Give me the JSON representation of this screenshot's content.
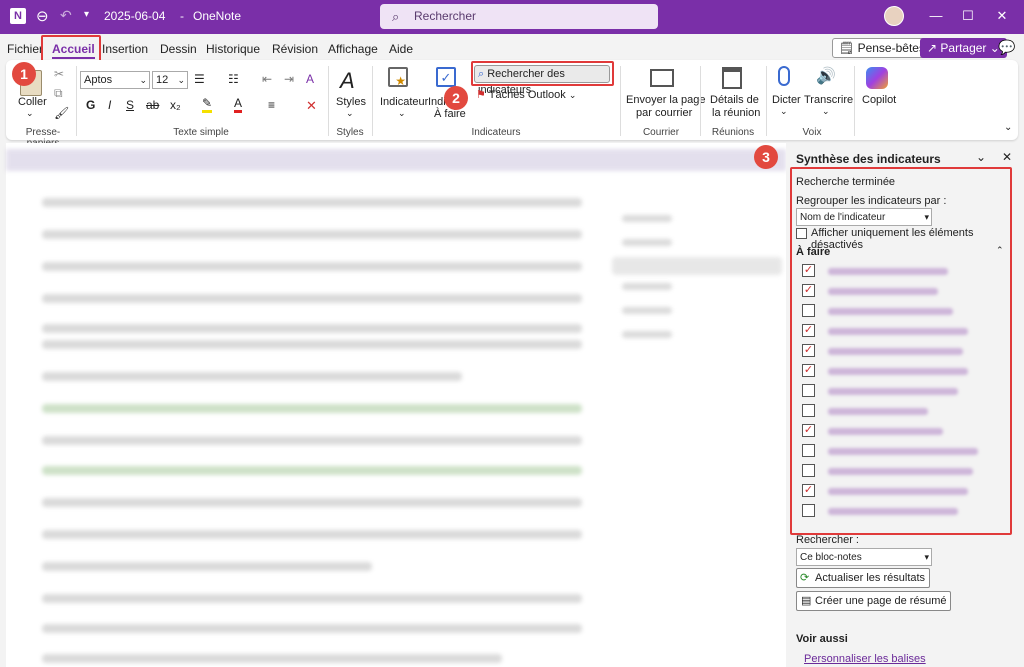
{
  "titlebar": {
    "date": "2025-06-04",
    "separator": "-",
    "app": "OneNote",
    "search_placeholder": "Rechercher"
  },
  "tabs": [
    "Fichier",
    "Accueil",
    "Insertion",
    "Dessin",
    "Historique",
    "Révision",
    "Affichage",
    "Aide"
  ],
  "top_buttons": {
    "pense_betes": "Pense-bêtes",
    "partager": "Partager"
  },
  "markers": [
    "1",
    "2",
    "3"
  ],
  "ribbon": {
    "clipboard": {
      "paste": "Coller",
      "group": "Presse-papiers"
    },
    "font": {
      "name": "Aptos",
      "size": "12",
      "group": "Texte simple"
    },
    "styles": {
      "label": "Styles",
      "group": "Styles"
    },
    "tags": {
      "indicator": "Indicateur",
      "todo_line1": "Indi",
      "todo_line2": "À faire",
      "find_tags": "Rechercher des indicateurs",
      "outlook_tasks": "Tâches Outlook",
      "group": "Indicateurs"
    },
    "email": {
      "line1": "Envoyer la page",
      "line2": "par courrier",
      "group": "Courrier"
    },
    "meeting": {
      "line1": "Détails de",
      "line2": "la réunion",
      "group": "Réunions"
    },
    "voice": {
      "dictate": "Dicter",
      "transcribe": "Transcrire",
      "group": "Voix"
    },
    "copilot": {
      "label": "Copilot"
    }
  },
  "pane": {
    "title": "Synthèse des indicateurs",
    "status": "Recherche terminée",
    "group_label": "Regrouper les indicateurs par :",
    "group_value": "Nom de l'indicateur",
    "show_unchecked": "Afficher uniquement les éléments désactivés",
    "section": "À faire",
    "items_checked": [
      true,
      true,
      false,
      true,
      true,
      true,
      false,
      false,
      true,
      false,
      false,
      true,
      false
    ],
    "search_label": "Rechercher :",
    "search_value": "Ce bloc-notes",
    "refresh": "Actualiser les résultats",
    "create_summary": "Créer une page de résumé",
    "see_also": "Voir aussi",
    "customize": "Personnaliser les balises"
  }
}
